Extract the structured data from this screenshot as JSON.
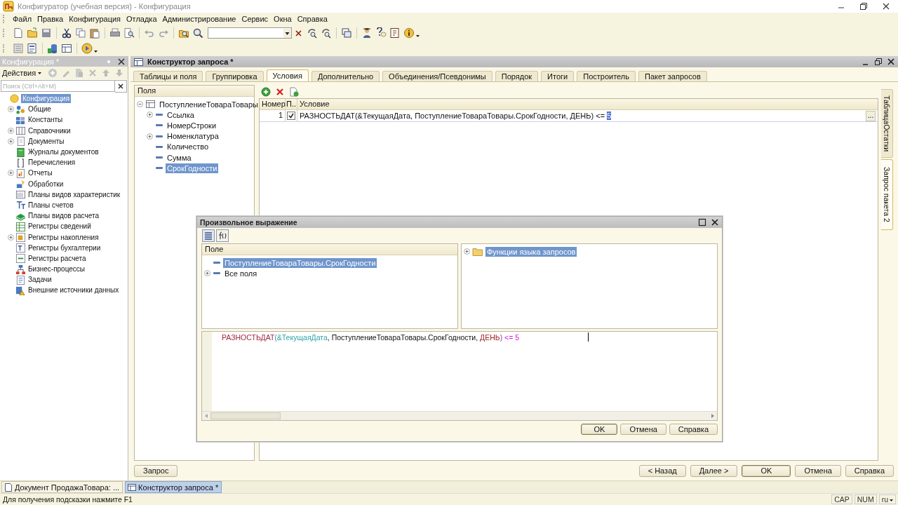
{
  "window": {
    "title": "Конфигуратор (учебная версия) - Конфигурация"
  },
  "menu": [
    "Файл",
    "Правка",
    "Конфигурация",
    "Отладка",
    "Администрирование",
    "Сервис",
    "Окна",
    "Справка"
  ],
  "config_panel": {
    "title": "Конфигурация *",
    "actions_label": "Действия",
    "search": {
      "placeholder": "Поиск (Ctrl+Alt+M)"
    },
    "tree": {
      "label": "Конфигурация",
      "selected": true,
      "children": [
        {
          "label": "Общие",
          "selected": false,
          "expanded": false
        },
        {
          "label": "Константы",
          "selected": false
        },
        {
          "label": "Справочники",
          "selected": false,
          "expanded": false
        },
        {
          "label": "Документы",
          "selected": false,
          "expanded": false
        },
        {
          "label": "Журналы документов",
          "selected": false
        },
        {
          "label": "Перечисления",
          "selected": false
        },
        {
          "label": "Отчеты",
          "selected": false,
          "expanded": false
        },
        {
          "label": "Обработки",
          "selected": false
        },
        {
          "label": "Планы видов характеристик",
          "selected": false
        },
        {
          "label": "Планы счетов",
          "selected": false
        },
        {
          "label": "Планы видов расчета",
          "selected": false
        },
        {
          "label": "Регистры сведений",
          "selected": false
        },
        {
          "label": "Регистры накопления",
          "selected": false,
          "expanded": false
        },
        {
          "label": "Регистры бухгалтерии",
          "selected": false
        },
        {
          "label": "Регистры расчета",
          "selected": false
        },
        {
          "label": "Бизнес-процессы",
          "selected": false
        },
        {
          "label": "Задачи",
          "selected": false
        },
        {
          "label": "Внешние источники данных",
          "selected": false
        }
      ]
    }
  },
  "query_builder": {
    "title": "Конструктор запроса *",
    "tabs": [
      {
        "label": "Таблицы и поля",
        "selected": false
      },
      {
        "label": "Группировка",
        "selected": false
      },
      {
        "label": "Условия",
        "selected": true
      },
      {
        "label": "Дополнительно",
        "selected": false
      },
      {
        "label": "Объединения/Псевдонимы",
        "selected": false
      },
      {
        "label": "Порядок",
        "selected": false
      },
      {
        "label": "Итоги",
        "selected": false
      },
      {
        "label": "Построитель",
        "selected": false
      },
      {
        "label": "Пакет запросов",
        "selected": false
      }
    ],
    "side_tabs": [
      {
        "label": "ТаблицаОстатки",
        "selected": false
      },
      {
        "label": "Запрос пакета 2",
        "selected": true
      }
    ],
    "fields_header": "Поля",
    "fields_tree": [
      {
        "label": "ПоступлениеТовараТовары",
        "selected": false,
        "expanded": true,
        "children": [
          {
            "label": "Ссылка",
            "selected": false,
            "expanded": false
          },
          {
            "label": "НомерСтроки",
            "selected": false
          },
          {
            "label": "Номенклатура",
            "selected": false,
            "expanded": false
          },
          {
            "label": "Количество",
            "selected": false
          },
          {
            "label": "Сумма",
            "selected": false
          },
          {
            "label": "СрокГодности",
            "selected": true
          }
        ]
      }
    ],
    "conditions": {
      "columns": [
        "Номер",
        "П..",
        "Условие"
      ],
      "rows": [
        {
          "number": "1",
          "checked": true,
          "condition": [
            {
              "text": "РАЗНОСТЬДАТ(&ТекущаяДата, ПоступлениеТовараТовары.СрокГодности, ДЕНЬ) <= ",
              "selected": false
            },
            {
              "text": "5",
              "selected": true
            }
          ],
          "button": "..."
        }
      ]
    },
    "query_button": "Запрос",
    "nav_buttons": [
      {
        "label": "< Назад",
        "default": false
      },
      {
        "label": "Далее >",
        "default": false
      },
      {
        "label": "OK",
        "default": true
      },
      {
        "label": "Отмена",
        "default": false
      },
      {
        "label": "Справка",
        "default": false
      }
    ]
  },
  "expression_dialog": {
    "title": "Произвольное выражение",
    "fields_header": "Поле",
    "fields_tree": [
      {
        "label": "ПоступлениеТовараТовары.СрокГодности",
        "selected": true
      },
      {
        "label": "Все поля",
        "selected": false,
        "expanded": false
      }
    ],
    "functions_tree": [
      {
        "label": "Функции языка запросов",
        "selected": true,
        "expanded": false
      }
    ],
    "expression": [
      {
        "text": "РАЗНОСТЬДАТ",
        "kind": "function"
      },
      {
        "text": "(&ТекущаяДата",
        "kind": "parameter"
      },
      {
        "text": ", ПоступлениеТовараТовары.СрокГодности, ",
        "kind": "plain"
      },
      {
        "text": "ДЕНЬ",
        "kind": "keyword"
      },
      {
        "text": ")",
        "kind": "bracket"
      },
      {
        "text": " <= 5",
        "kind": "number"
      }
    ],
    "buttons": [
      {
        "label": "OK",
        "default": true
      },
      {
        "label": "Отмена",
        "default": false
      },
      {
        "label": "Справка",
        "default": false
      }
    ]
  },
  "taskbar": [
    {
      "label": "Документ ПродажаТовара: ...",
      "selected": false
    },
    {
      "label": "Конструктор запроса *",
      "selected": true
    }
  ],
  "status_bar": {
    "hint": "Для получения подсказки нажмите F1",
    "indicators": [
      "CAP",
      "NUM"
    ],
    "language": "ru"
  }
}
